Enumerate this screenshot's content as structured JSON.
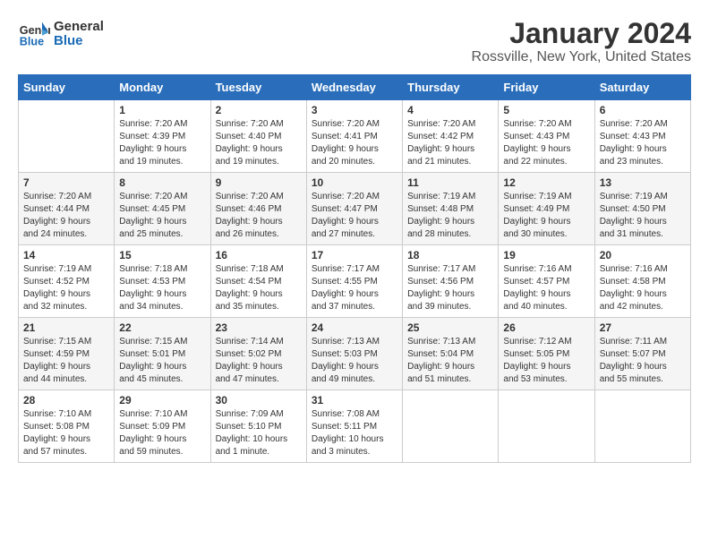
{
  "logo": {
    "name_part1": "General",
    "name_part2": "Blue"
  },
  "title": "January 2024",
  "subtitle": "Rossville, New York, United States",
  "days_of_week": [
    "Sunday",
    "Monday",
    "Tuesday",
    "Wednesday",
    "Thursday",
    "Friday",
    "Saturday"
  ],
  "weeks": [
    [
      {
        "day": "",
        "info": ""
      },
      {
        "day": "1",
        "info": "Sunrise: 7:20 AM\nSunset: 4:39 PM\nDaylight: 9 hours\nand 19 minutes."
      },
      {
        "day": "2",
        "info": "Sunrise: 7:20 AM\nSunset: 4:40 PM\nDaylight: 9 hours\nand 19 minutes."
      },
      {
        "day": "3",
        "info": "Sunrise: 7:20 AM\nSunset: 4:41 PM\nDaylight: 9 hours\nand 20 minutes."
      },
      {
        "day": "4",
        "info": "Sunrise: 7:20 AM\nSunset: 4:42 PM\nDaylight: 9 hours\nand 21 minutes."
      },
      {
        "day": "5",
        "info": "Sunrise: 7:20 AM\nSunset: 4:43 PM\nDaylight: 9 hours\nand 22 minutes."
      },
      {
        "day": "6",
        "info": "Sunrise: 7:20 AM\nSunset: 4:43 PM\nDaylight: 9 hours\nand 23 minutes."
      }
    ],
    [
      {
        "day": "7",
        "info": "Sunrise: 7:20 AM\nSunset: 4:44 PM\nDaylight: 9 hours\nand 24 minutes."
      },
      {
        "day": "8",
        "info": "Sunrise: 7:20 AM\nSunset: 4:45 PM\nDaylight: 9 hours\nand 25 minutes."
      },
      {
        "day": "9",
        "info": "Sunrise: 7:20 AM\nSunset: 4:46 PM\nDaylight: 9 hours\nand 26 minutes."
      },
      {
        "day": "10",
        "info": "Sunrise: 7:20 AM\nSunset: 4:47 PM\nDaylight: 9 hours\nand 27 minutes."
      },
      {
        "day": "11",
        "info": "Sunrise: 7:19 AM\nSunset: 4:48 PM\nDaylight: 9 hours\nand 28 minutes."
      },
      {
        "day": "12",
        "info": "Sunrise: 7:19 AM\nSunset: 4:49 PM\nDaylight: 9 hours\nand 30 minutes."
      },
      {
        "day": "13",
        "info": "Sunrise: 7:19 AM\nSunset: 4:50 PM\nDaylight: 9 hours\nand 31 minutes."
      }
    ],
    [
      {
        "day": "14",
        "info": "Sunrise: 7:19 AM\nSunset: 4:52 PM\nDaylight: 9 hours\nand 32 minutes."
      },
      {
        "day": "15",
        "info": "Sunrise: 7:18 AM\nSunset: 4:53 PM\nDaylight: 9 hours\nand 34 minutes."
      },
      {
        "day": "16",
        "info": "Sunrise: 7:18 AM\nSunset: 4:54 PM\nDaylight: 9 hours\nand 35 minutes."
      },
      {
        "day": "17",
        "info": "Sunrise: 7:17 AM\nSunset: 4:55 PM\nDaylight: 9 hours\nand 37 minutes."
      },
      {
        "day": "18",
        "info": "Sunrise: 7:17 AM\nSunset: 4:56 PM\nDaylight: 9 hours\nand 39 minutes."
      },
      {
        "day": "19",
        "info": "Sunrise: 7:16 AM\nSunset: 4:57 PM\nDaylight: 9 hours\nand 40 minutes."
      },
      {
        "day": "20",
        "info": "Sunrise: 7:16 AM\nSunset: 4:58 PM\nDaylight: 9 hours\nand 42 minutes."
      }
    ],
    [
      {
        "day": "21",
        "info": "Sunrise: 7:15 AM\nSunset: 4:59 PM\nDaylight: 9 hours\nand 44 minutes."
      },
      {
        "day": "22",
        "info": "Sunrise: 7:15 AM\nSunset: 5:01 PM\nDaylight: 9 hours\nand 45 minutes."
      },
      {
        "day": "23",
        "info": "Sunrise: 7:14 AM\nSunset: 5:02 PM\nDaylight: 9 hours\nand 47 minutes."
      },
      {
        "day": "24",
        "info": "Sunrise: 7:13 AM\nSunset: 5:03 PM\nDaylight: 9 hours\nand 49 minutes."
      },
      {
        "day": "25",
        "info": "Sunrise: 7:13 AM\nSunset: 5:04 PM\nDaylight: 9 hours\nand 51 minutes."
      },
      {
        "day": "26",
        "info": "Sunrise: 7:12 AM\nSunset: 5:05 PM\nDaylight: 9 hours\nand 53 minutes."
      },
      {
        "day": "27",
        "info": "Sunrise: 7:11 AM\nSunset: 5:07 PM\nDaylight: 9 hours\nand 55 minutes."
      }
    ],
    [
      {
        "day": "28",
        "info": "Sunrise: 7:10 AM\nSunset: 5:08 PM\nDaylight: 9 hours\nand 57 minutes."
      },
      {
        "day": "29",
        "info": "Sunrise: 7:10 AM\nSunset: 5:09 PM\nDaylight: 9 hours\nand 59 minutes."
      },
      {
        "day": "30",
        "info": "Sunrise: 7:09 AM\nSunset: 5:10 PM\nDaylight: 10 hours\nand 1 minute."
      },
      {
        "day": "31",
        "info": "Sunrise: 7:08 AM\nSunset: 5:11 PM\nDaylight: 10 hours\nand 3 minutes."
      },
      {
        "day": "",
        "info": ""
      },
      {
        "day": "",
        "info": ""
      },
      {
        "day": "",
        "info": ""
      }
    ]
  ]
}
